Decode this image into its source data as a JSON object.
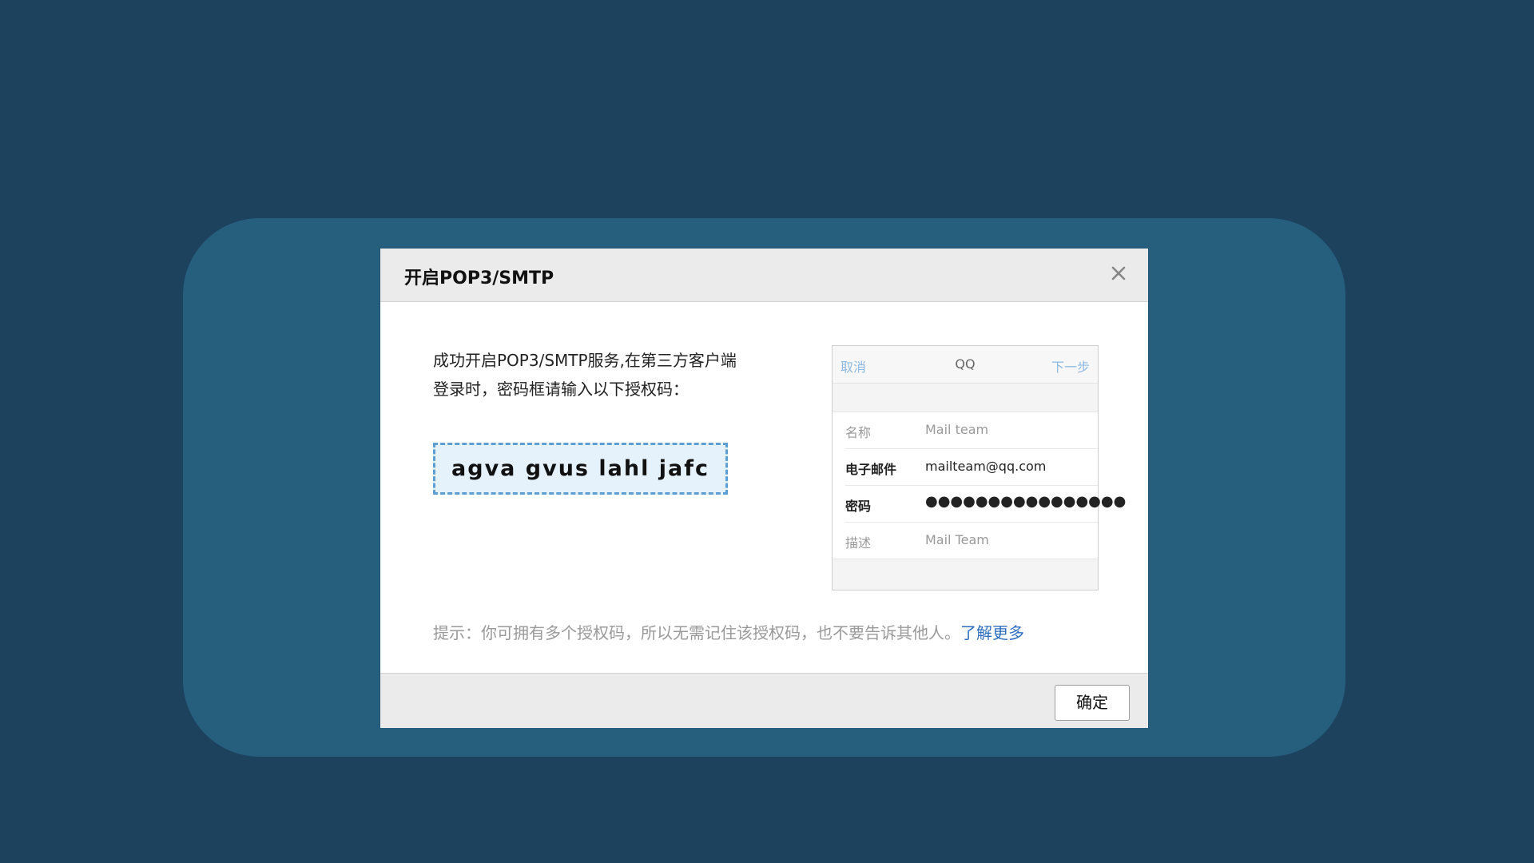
{
  "dialog": {
    "title": "开启POP3/SMTP",
    "close_icon": "close-icon",
    "message_line1": "成功开启POP3/SMTP服务,在第三方客户端",
    "message_line2": "登录时，密码框请输入以下授权码：",
    "auth_code": "agva gvus lahl jafc",
    "hint_text": "提示：你可拥有多个授权码，所以无需记住该授权码，也不要告诉其他人。",
    "hint_link": "了解更多",
    "ok_label": "确定"
  },
  "mock": {
    "cancel": "取消",
    "title": "QQ",
    "next": "下一步",
    "rows": [
      {
        "label": "名称",
        "value": "Mail team",
        "active": false
      },
      {
        "label": "电子邮件",
        "value": "mailteam@qq.com",
        "active": true
      },
      {
        "label": "密码",
        "value": "●●●●●●●●●●●●●●●●",
        "active": true
      },
      {
        "label": "描述",
        "value": "Mail Team",
        "active": false
      }
    ]
  },
  "colors": {
    "page_bg": "#1c425d",
    "backdrop": "#265e7e",
    "accent_link": "#2f6fbf",
    "code_border": "#5e9fd3"
  }
}
